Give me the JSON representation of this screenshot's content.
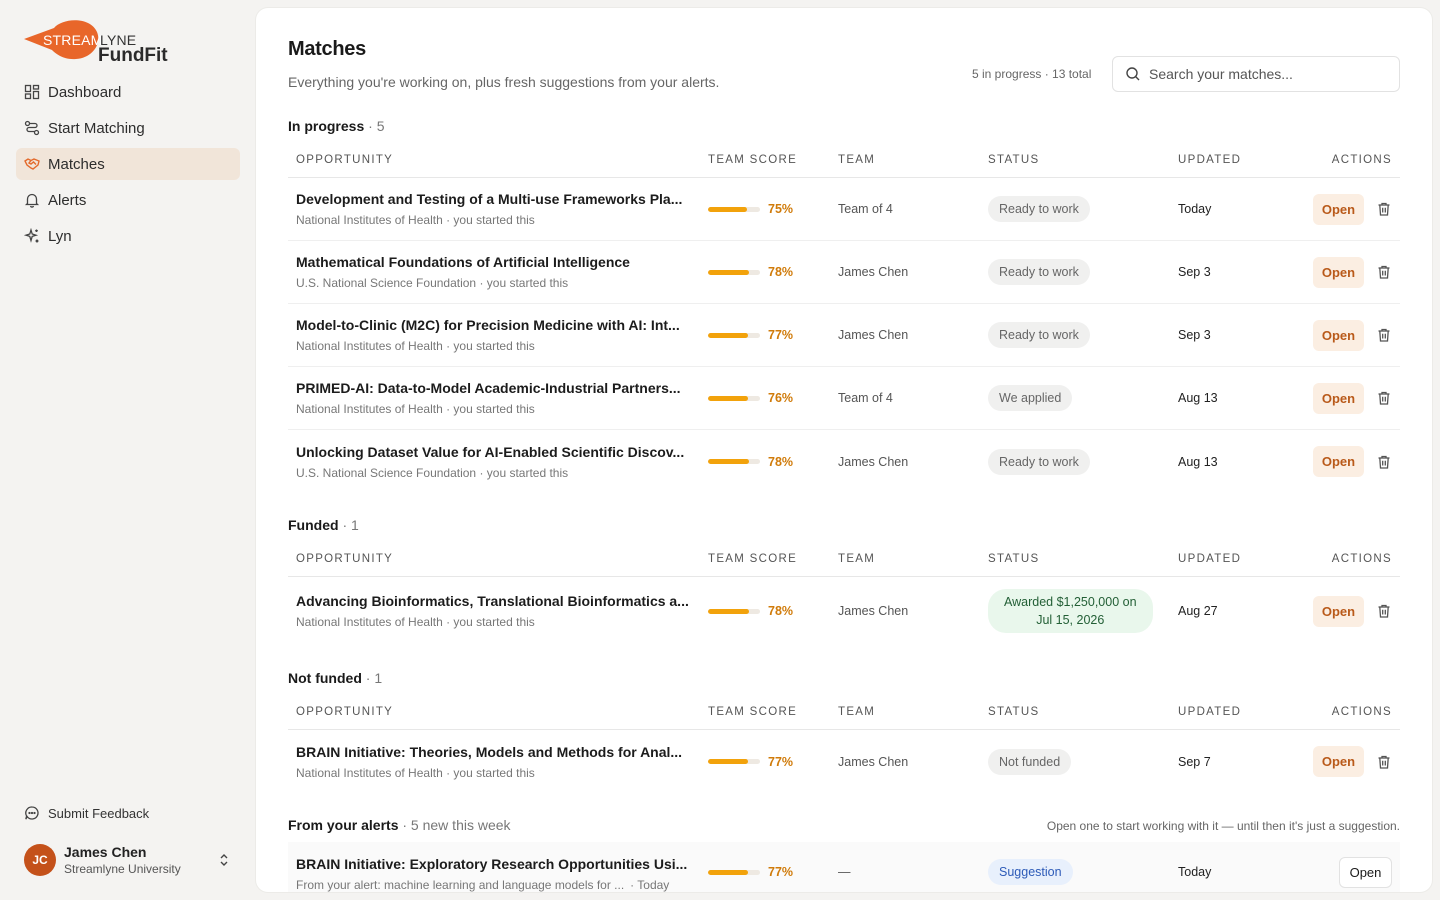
{
  "brand": {
    "stream": "STREAM",
    "lyne": "LYNE",
    "product": "FundFit",
    "accent": "#e8662a"
  },
  "nav": [
    {
      "label": "Dashboard",
      "icon": "grid-icon",
      "active": false
    },
    {
      "label": "Start Matching",
      "icon": "route-icon",
      "active": false
    },
    {
      "label": "Matches",
      "icon": "handshake-icon",
      "active": true
    },
    {
      "label": "Alerts",
      "icon": "bell-icon",
      "active": false
    },
    {
      "label": "Lyn",
      "icon": "sparkle-icon",
      "active": false
    }
  ],
  "feedback_label": "Submit Feedback",
  "user": {
    "initials": "JC",
    "name": "James Chen",
    "org": "Streamlyne University"
  },
  "page": {
    "title": "Matches",
    "subtitle": "Everything you're working on, plus fresh suggestions from your alerts.",
    "summary": "5 in progress · 13 total",
    "search_placeholder": "Search your matches..."
  },
  "columns": [
    "Opportunity",
    "Team score",
    "Team",
    "Status",
    "Updated",
    "Actions"
  ],
  "open_label": "Open",
  "sections": {
    "in_progress": {
      "title": "In progress",
      "count": "· 5",
      "rows": [
        {
          "title": "Development and Testing of a Multi-use Frameworks Pla...",
          "meta": "National Institutes of Health · you started this",
          "score": 0.75,
          "pct": "75%",
          "team": "Team of 4",
          "status": "Ready to work",
          "updated": "Today"
        },
        {
          "title": "Mathematical Foundations of Artificial Intelligence",
          "meta": "U.S. National Science Foundation · you started this",
          "score": 0.78,
          "pct": "78%",
          "team": "James Chen",
          "status": "Ready to work",
          "updated": "Sep 3"
        },
        {
          "title": "Model-to-Clinic (M2C) for Precision Medicine with AI: Int...",
          "meta": "National Institutes of Health · you started this",
          "score": 0.77,
          "pct": "77%",
          "team": "James Chen",
          "status": "Ready to work",
          "updated": "Sep 3"
        },
        {
          "title": "PRIMED-AI: Data-to-Model Academic-Industrial Partners...",
          "meta": "National Institutes of Health · you started this",
          "score": 0.76,
          "pct": "76%",
          "team": "Team of 4",
          "status": "We applied",
          "updated": "Aug 13"
        },
        {
          "title": "Unlocking Dataset Value for AI-Enabled Scientific Discov...",
          "meta": "U.S. National Science Foundation · you started this",
          "score": 0.78,
          "pct": "78%",
          "team": "James Chen",
          "status": "Ready to work",
          "updated": "Aug 13"
        }
      ]
    },
    "funded": {
      "title": "Funded",
      "count": "· 1",
      "rows": [
        {
          "title": "Advancing Bioinformatics, Translational Bioinformatics a...",
          "meta": "National Institutes of Health · you started this",
          "score": 0.78,
          "pct": "78%",
          "team": "James Chen",
          "status_line1": "Awarded $1,250,000 on",
          "status_line2": "Jul 15, 2026",
          "updated": "Aug 27"
        }
      ]
    },
    "not_funded": {
      "title": "Not funded",
      "count": "· 1",
      "rows": [
        {
          "title": "BRAIN Initiative: Theories, Models and Methods for Anal...",
          "meta": "National Institutes of Health · you started this",
          "score": 0.77,
          "pct": "77%",
          "team": "James Chen",
          "status": "Not funded",
          "updated": "Sep 7"
        }
      ]
    },
    "alerts": {
      "title": "From your alerts",
      "count": "· 5 new this week",
      "note": "Open one to start working with it — until then it's just a suggestion.",
      "rows": [
        {
          "title": "BRAIN Initiative: Exploratory Research Opportunities Usi...",
          "meta": "From your alert: machine learning and language models for ...",
          "meta_when": "· Today",
          "score": 0.77,
          "pct": "77%",
          "team": "—",
          "status": "Suggestion",
          "updated": "Today"
        }
      ]
    }
  }
}
